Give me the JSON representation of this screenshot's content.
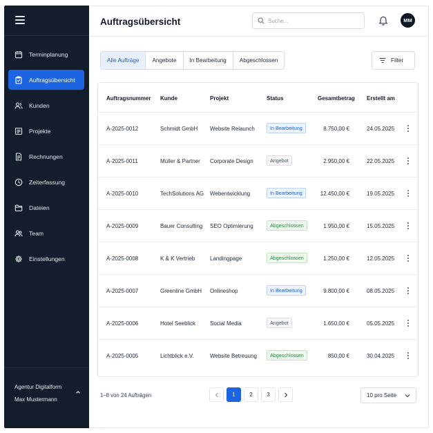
{
  "sidebar": {
    "items": [
      {
        "label": "Terminplanung",
        "icon": "calendar-icon"
      },
      {
        "label": "Auftragsübersicht",
        "icon": "clipboard-icon",
        "active": true
      },
      {
        "label": "Kunden",
        "icon": "users-icon"
      },
      {
        "label": "Projekte",
        "icon": "project-icon"
      },
      {
        "label": "Rechnungen",
        "icon": "invoice-icon"
      },
      {
        "label": "Zeiterfassung",
        "icon": "clock-icon"
      },
      {
        "label": "Dateien",
        "icon": "folder-icon"
      },
      {
        "label": "Team",
        "icon": "team-icon"
      },
      {
        "label": "Einstellungen",
        "icon": "gear-icon"
      }
    ],
    "account": {
      "org": "Agentur Digitalform",
      "user": "Max Mustermann"
    }
  },
  "header": {
    "title": "Auftragsübersicht",
    "search_placeholder": "Suche...",
    "avatar_initials": "MM"
  },
  "tabs": [
    {
      "label": "Alle Aufträge",
      "active": true
    },
    {
      "label": "Angebote",
      "active": false
    },
    {
      "label": "In Bearbeitung",
      "active": false
    },
    {
      "label": "Abgeschlossen",
      "active": false
    }
  ],
  "filter_label": "Filter",
  "table": {
    "headers": [
      "Auftragsnummer",
      "Kunde",
      "Projekt",
      "Status",
      "Gesamtbetrag",
      "Erstellt am"
    ],
    "rows": [
      {
        "nr": "A-2025-0012",
        "kunde": "Schmidt GmbH",
        "projekt": "Website Relaunch",
        "status": "In Bearbeitung",
        "status_color": "blue",
        "betrag": "8.750,00 €",
        "datum": "24.05.2025"
      },
      {
        "nr": "A-2025-0011",
        "kunde": "Müller & Partner",
        "projekt": "Corporate Design",
        "status": "Angebot",
        "status_color": "gray",
        "betrag": "2.950,00 €",
        "datum": "22.05.2025"
      },
      {
        "nr": "A-2025-0010",
        "kunde": "TechSolutions AG",
        "projekt": "Webentwicklung",
        "status": "In Bearbeitung",
        "status_color": "blue",
        "betrag": "12.450,00 €",
        "datum": "19.05.2025"
      },
      {
        "nr": "A-2025-0009",
        "kunde": "Bauer Consulting",
        "projekt": "SEO Optimierung",
        "status": "Abgeschlossen",
        "status_color": "green",
        "betrag": "1.950,00 €",
        "datum": "15.05.2025"
      },
      {
        "nr": "A-2025-0008",
        "kunde": "K & K Vertrieb",
        "projekt": "Landingpage",
        "status": "Abgeschlossen",
        "status_color": "green",
        "betrag": "1.250,00 €",
        "datum": "12.05.2025"
      },
      {
        "nr": "A-2025-0007",
        "kunde": "Greenline GmbH",
        "projekt": "Onlineshop",
        "status": "In Bearbeitung",
        "status_color": "blue",
        "betrag": "9.800,00 €",
        "datum": "08.05.2025"
      },
      {
        "nr": "A-2025-0006",
        "kunde": "Hotel Seeblick",
        "projekt": "Social Media",
        "status": "Angebot",
        "status_color": "gray",
        "betrag": "1.650,00 €",
        "datum": "05.05.2025"
      },
      {
        "nr": "A-2025-0005",
        "kunde": "Lichtblick e.V.",
        "projekt": "Website Betreuung",
        "status": "Abgeschlossen",
        "status_color": "green",
        "betrag": "850,00 €",
        "datum": "30.04.2025"
      }
    ]
  },
  "pagination": {
    "info": "1–8 von 24 Aufträgen",
    "pages": [
      "1",
      "2",
      "3"
    ],
    "current": "1",
    "per_page": "10 pro Seite"
  },
  "colors": {
    "sidebar_bg": "#131d2c",
    "accent": "#1d64e0",
    "status_blue": "#1d64e0",
    "status_green": "#2f8a3f",
    "status_gray": "#4b5563"
  }
}
